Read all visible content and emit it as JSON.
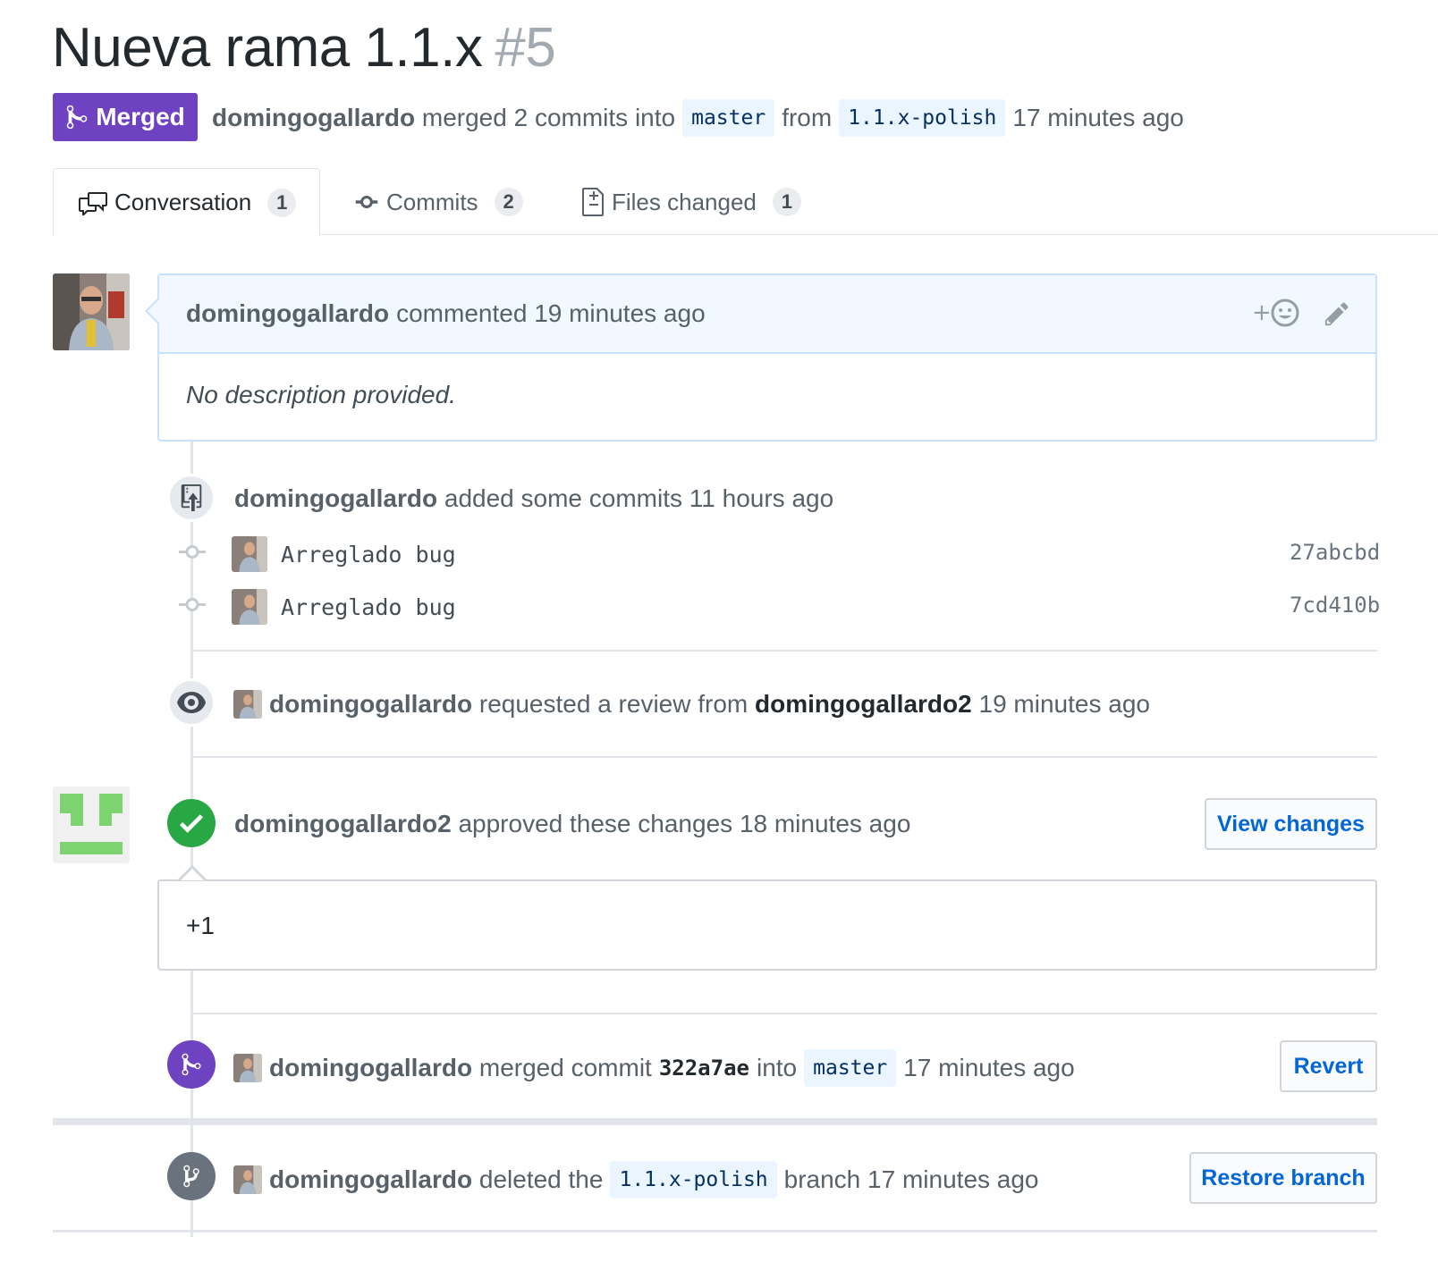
{
  "header": {
    "title": "Nueva rama 1.1.x",
    "number": "#5",
    "state_label": "Merged",
    "author": "domingogallardo",
    "merged_text": "merged 2 commits into",
    "base_branch": "master",
    "from_text": "from",
    "head_branch": "1.1.x-polish",
    "time": "17 minutes ago"
  },
  "tabs": [
    {
      "label": "Conversation",
      "count": "1",
      "icon": "comment-discussion-icon",
      "selected": true
    },
    {
      "label": "Commits",
      "count": "2",
      "icon": "git-commit-icon",
      "selected": false
    },
    {
      "label": "Files changed",
      "count": "1",
      "icon": "diff-icon",
      "selected": false
    }
  ],
  "comment": {
    "author": "domingogallardo",
    "action": "commented",
    "time": "19 minutes ago",
    "body": "No description provided."
  },
  "commits_event": {
    "author": "domingogallardo",
    "action": "added some commits",
    "time": "11 hours ago",
    "commits": [
      {
        "message": "Arreglado bug",
        "sha": "27abcbd"
      },
      {
        "message": "Arreglado bug",
        "sha": "7cd410b"
      }
    ]
  },
  "review_request": {
    "author": "domingogallardo",
    "action": "requested a review from",
    "reviewer": "domingogallardo2",
    "time": "19 minutes ago"
  },
  "approval": {
    "author": "domingogallardo2",
    "action": "approved these changes",
    "time": "18 minutes ago",
    "button": "View changes",
    "body": "+1"
  },
  "merge_event": {
    "author": "domingogallardo",
    "action": "merged commit",
    "sha": "322a7ae",
    "into": "into",
    "branch": "master",
    "time": "17 minutes ago",
    "button": "Revert"
  },
  "delete_event": {
    "author": "domingogallardo",
    "action": "deleted the",
    "branch": "1.1.x-polish",
    "suffix": "branch",
    "time": "17 minutes ago",
    "button": "Restore branch"
  },
  "colors": {
    "merged_purple": "#6f42c1",
    "approved_green": "#28a745",
    "link_blue": "#0366d6",
    "branch_bg": "#eaf5ff"
  }
}
